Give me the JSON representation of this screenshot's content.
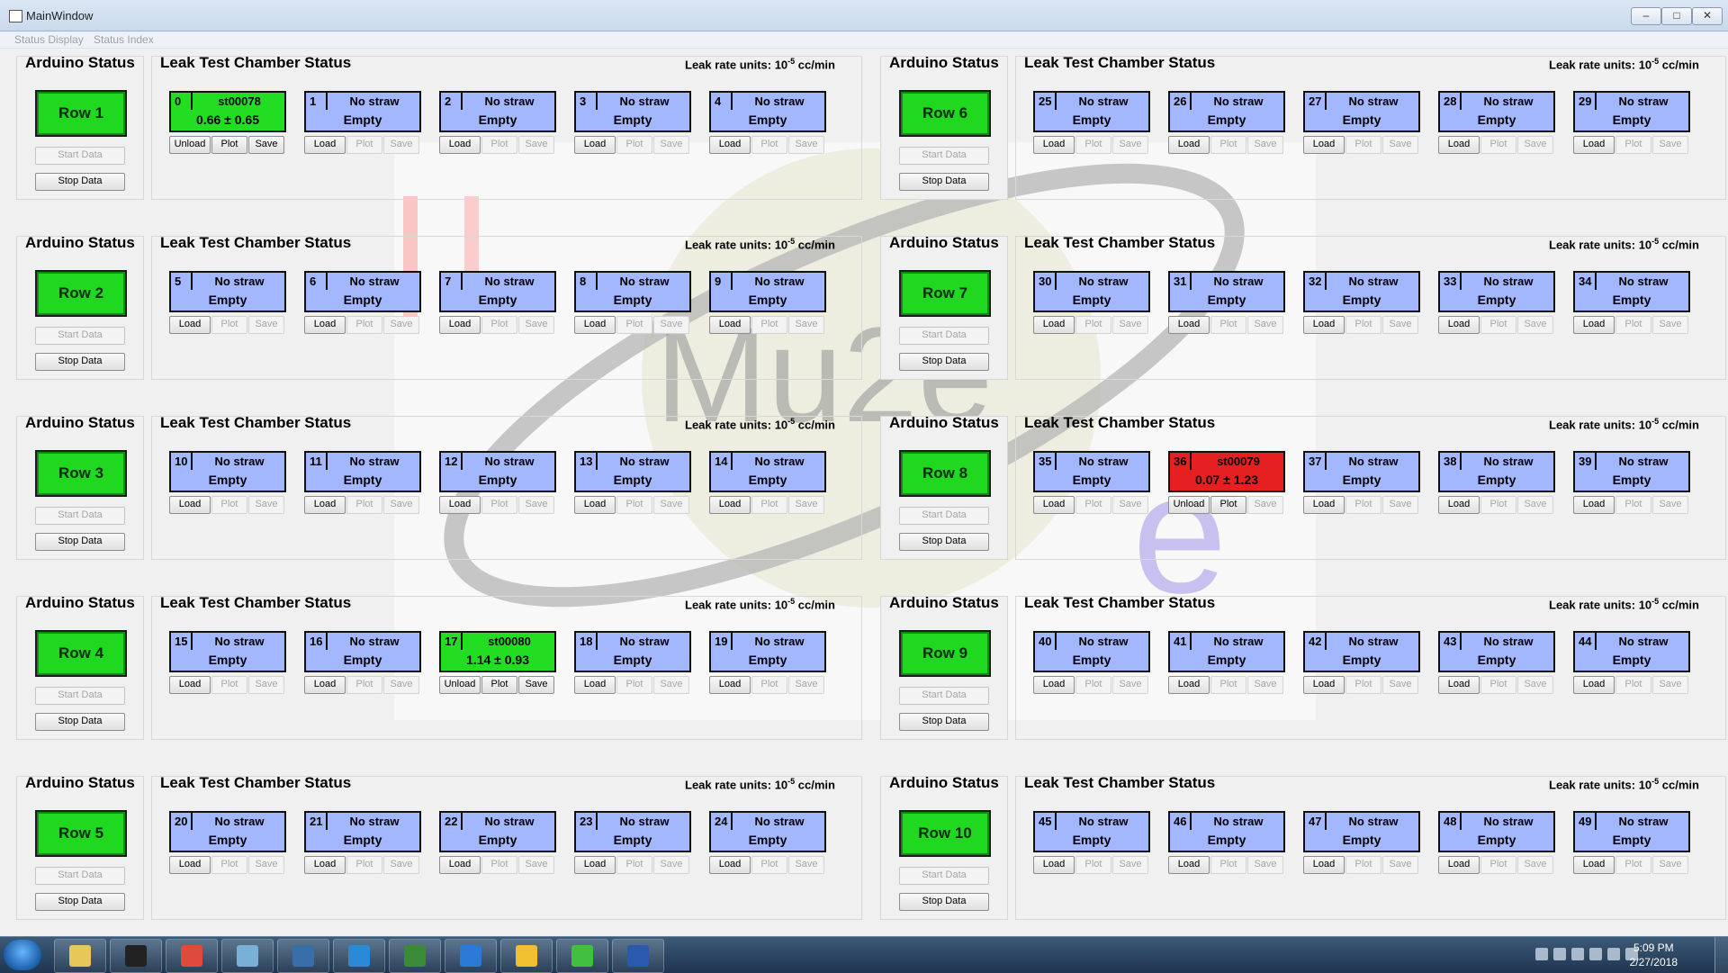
{
  "window": {
    "title": "MainWindow"
  },
  "menu": [
    "Status Display",
    "Status Index"
  ],
  "labels": {
    "arduino_title": "Arduino Status",
    "chamber_title": "Leak Test Chamber Status",
    "units_prefix": "Leak rate units: 10",
    "units_exp": "-5",
    "units_suffix": " cc/min",
    "start_data": "Start Data",
    "stop_data": "Stop Data",
    "load": "Load",
    "unload": "Unload",
    "plot": "Plot",
    "save": "Save",
    "no_straw": "No straw",
    "empty": "Empty"
  },
  "rows": [
    "Row 1",
    "Row 2",
    "Row 3",
    "Row 4",
    "Row 5",
    "Row 6",
    "Row 7",
    "Row 8",
    "Row 9",
    "Row 10"
  ],
  "chambers": [
    {
      "n": "0",
      "straw": "st00078",
      "status": "0.66 ± 0.65",
      "state": "green"
    },
    {
      "n": "1",
      "state": "empty"
    },
    {
      "n": "2",
      "state": "empty"
    },
    {
      "n": "3",
      "state": "empty"
    },
    {
      "n": "4",
      "state": "empty"
    },
    {
      "n": "5",
      "state": "empty"
    },
    {
      "n": "6",
      "state": "empty"
    },
    {
      "n": "7",
      "state": "empty"
    },
    {
      "n": "8",
      "state": "empty"
    },
    {
      "n": "9",
      "state": "empty"
    },
    {
      "n": "10",
      "state": "empty"
    },
    {
      "n": "11",
      "state": "empty"
    },
    {
      "n": "12",
      "state": "empty"
    },
    {
      "n": "13",
      "state": "empty"
    },
    {
      "n": "14",
      "state": "empty"
    },
    {
      "n": "15",
      "state": "empty"
    },
    {
      "n": "16",
      "state": "empty"
    },
    {
      "n": "17",
      "straw": "st00080",
      "status": "1.14 ± 0.93",
      "state": "green"
    },
    {
      "n": "18",
      "state": "empty"
    },
    {
      "n": "19",
      "state": "empty"
    },
    {
      "n": "20",
      "state": "empty"
    },
    {
      "n": "21",
      "state": "empty"
    },
    {
      "n": "22",
      "state": "empty"
    },
    {
      "n": "23",
      "state": "empty"
    },
    {
      "n": "24",
      "state": "empty"
    },
    {
      "n": "25",
      "state": "empty"
    },
    {
      "n": "26",
      "state": "empty"
    },
    {
      "n": "27",
      "state": "empty"
    },
    {
      "n": "28",
      "state": "empty"
    },
    {
      "n": "29",
      "state": "empty"
    },
    {
      "n": "30",
      "state": "empty"
    },
    {
      "n": "31",
      "state": "empty"
    },
    {
      "n": "32",
      "state": "empty"
    },
    {
      "n": "33",
      "state": "empty"
    },
    {
      "n": "34",
      "state": "empty"
    },
    {
      "n": "35",
      "state": "empty"
    },
    {
      "n": "36",
      "straw": "st00079",
      "status": "0.07 ± 1.23",
      "state": "red"
    },
    {
      "n": "37",
      "state": "empty"
    },
    {
      "n": "38",
      "state": "empty"
    },
    {
      "n": "39",
      "state": "empty"
    },
    {
      "n": "40",
      "state": "empty"
    },
    {
      "n": "41",
      "state": "empty"
    },
    {
      "n": "42",
      "state": "empty"
    },
    {
      "n": "43",
      "state": "empty"
    },
    {
      "n": "44",
      "state": "empty"
    },
    {
      "n": "45",
      "state": "empty"
    },
    {
      "n": "46",
      "state": "empty"
    },
    {
      "n": "47",
      "state": "empty"
    },
    {
      "n": "48",
      "state": "empty"
    },
    {
      "n": "49",
      "state": "empty"
    }
  ],
  "watermark": {
    "text1": "Mu2e",
    "text2": "e"
  },
  "taskbar": {
    "time": "5:09 PM",
    "date": "2/27/2018",
    "apps": [
      "file-explorer-icon",
      "terminal-icon",
      "chrome-icon",
      "notepad-icon",
      "python-icon",
      "cloud-icon",
      "monitor-icon",
      "ie-icon",
      "python2-icon",
      "qt-icon",
      "word-icon"
    ]
  },
  "colors": {
    "empty": "#a3b7ff",
    "loaded": "#22dd22",
    "failed": "#e62020",
    "row_ok": "#1fd81f"
  }
}
